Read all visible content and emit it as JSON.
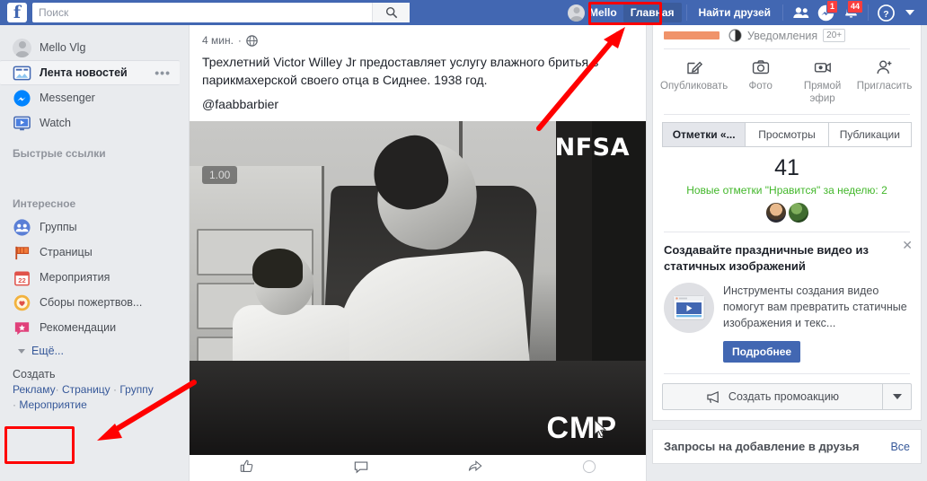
{
  "topbar": {
    "logo": "f",
    "search_placeholder": "Поиск",
    "search_value": "",
    "search_icon": "search-icon",
    "profile_name": "Mello",
    "home_label": "Главная",
    "find_friends_label": "Найти друзей",
    "friend_requests_icon": "friends-icon",
    "messages_icon": "messenger-icon",
    "messages_badge": "1",
    "notifications_icon": "bell-icon",
    "notifications_badge": "44",
    "help_icon": "question-circle-icon",
    "menu_icon": "chevron-down-icon"
  },
  "sidebar": {
    "user": {
      "name": "Mello Vlg",
      "icon": "avatar"
    },
    "primary": [
      {
        "label": "Лента новостей",
        "icon": "newsfeed-icon",
        "selected": true,
        "menu": "•••"
      },
      {
        "label": "Messenger",
        "icon": "messenger-icon",
        "selected": false
      },
      {
        "label": "Watch",
        "icon": "watch-icon",
        "selected": false
      }
    ],
    "quick_links_heading": "Быстрые ссылки",
    "explore_heading": "Интересное",
    "explore": [
      {
        "label": "Группы",
        "icon": "groups-icon"
      },
      {
        "label": "Страницы",
        "icon": "pages-flag-icon"
      },
      {
        "label": "Мероприятия",
        "icon": "events-calendar-icon"
      },
      {
        "label": "Сборы пожертвов...",
        "icon": "fundraisers-icon"
      },
      {
        "label": "Рекомендации",
        "icon": "recommendations-icon"
      }
    ],
    "more_label": "Ещё...",
    "create": {
      "title": "Создать",
      "links": [
        "Рекламу",
        "Страницу",
        "Группу",
        "Мероприятие"
      ],
      "separator": "·"
    }
  },
  "feed": {
    "post": {
      "time": "4 мин.",
      "separator": "·",
      "privacy_icon": "globe-icon",
      "text": "Трехлетний Victor Willey Jr предоставляет услугу влажного бритья в парикмахерской своего отца в Сиднее. 1938 год.",
      "tag": "@faabbarbier",
      "media": {
        "duration_badge": "1.00",
        "watermark_top": "NFSA",
        "watermark_bottom": "CMP",
        "cursor_icon": "cursor-arrow-icon"
      },
      "actions": [
        {
          "label": "Нравится",
          "icon": "like-thumb-icon"
        },
        {
          "label": "Комментировать",
          "icon": "comment-icon"
        },
        {
          "label": "Поделиться",
          "icon": "share-icon"
        },
        {
          "label": "Реакция",
          "icon": "emoji-icon"
        }
      ]
    }
  },
  "right": {
    "page_card": {
      "orange_tab": "",
      "notifications_label": "Уведомления",
      "notifications_count": "20+",
      "notifications_icon": "globe-notif-icon",
      "actions": [
        {
          "label": "Опубликовать",
          "icon": "compose-pencil-icon"
        },
        {
          "label": "Фото",
          "icon": "camera-icon"
        },
        {
          "label": "Прямой эфир",
          "icon": "live-video-icon"
        },
        {
          "label": "Пригласить",
          "icon": "invite-person-icon"
        }
      ],
      "tabs": [
        {
          "label": "Отметки «...",
          "active": true
        },
        {
          "label": "Просмотры",
          "active": false
        },
        {
          "label": "Публикации",
          "active": false
        }
      ],
      "stat_number": "41",
      "stat_sub": "Новые отметки \"Нравится\" за неделю: 2",
      "avatars": [
        "avatar-person",
        "avatar-nature"
      ],
      "promo": {
        "close_icon": "close-x-icon",
        "title": "Создавайте праздничные видео из статичных изображений",
        "thumb_icon": "video-play-icon",
        "text": "Инструменты создания видео помогут вам превратить статичные изображения и текс...",
        "button": "Подробнее"
      },
      "promote_button": {
        "label": "Создать промоакцию",
        "icon": "megaphone-icon",
        "caret_icon": "chevron-down-icon"
      }
    },
    "requests_card": {
      "title": "Запросы на добавление в друзья",
      "see_all": "Все"
    }
  },
  "annotations": {
    "color": "#ff0000",
    "rect_home": "Главная",
    "rect_create": "Создать / Рекламу",
    "arrow_home": "arrow-to-home",
    "arrow_create": "arrow-to-create"
  }
}
